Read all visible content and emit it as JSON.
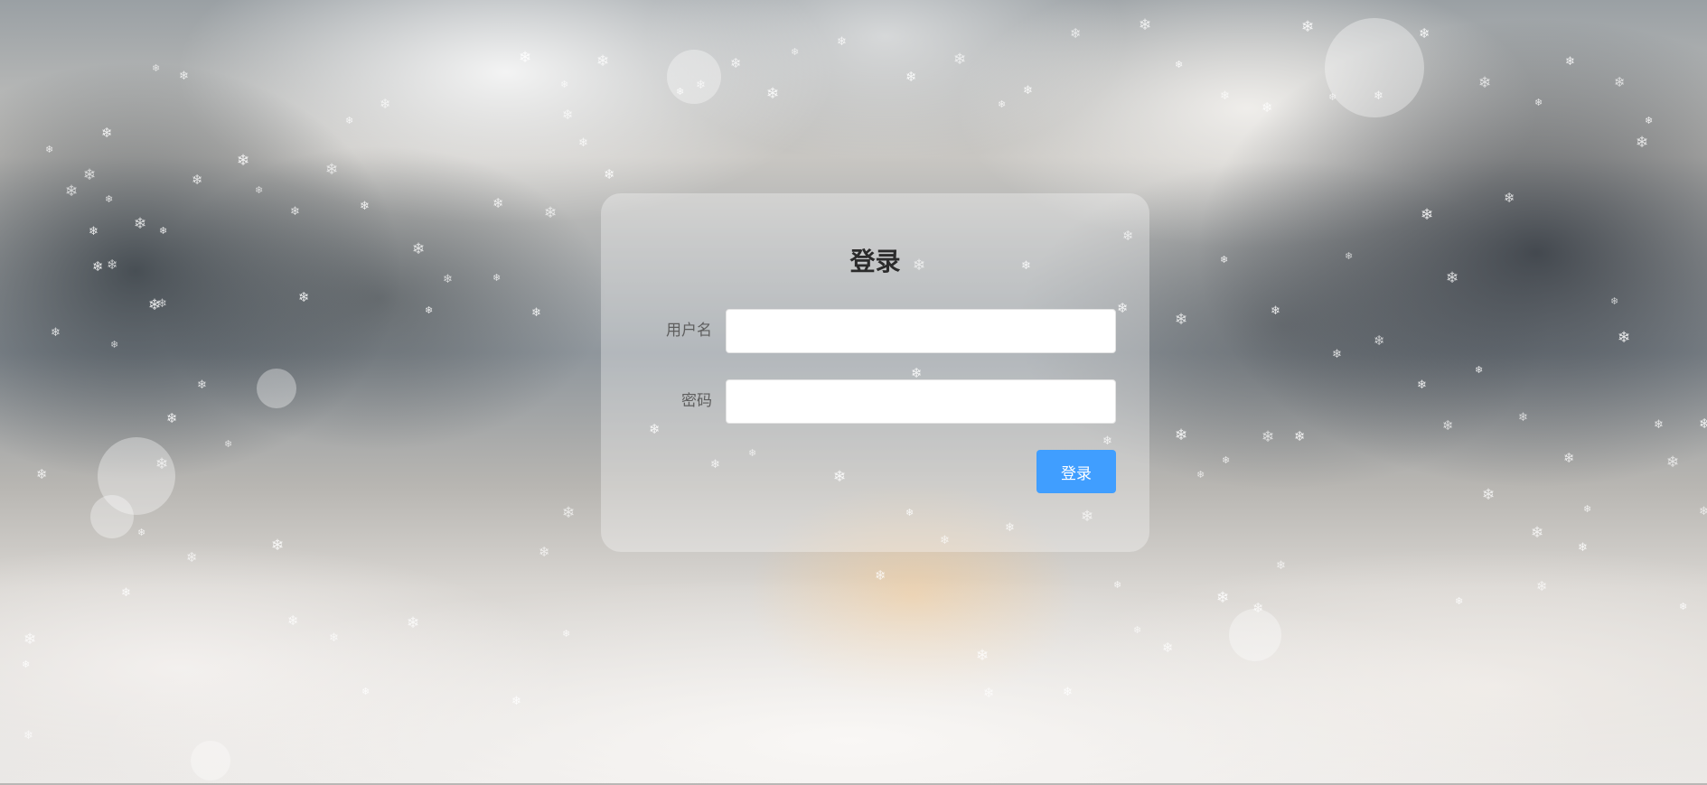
{
  "login": {
    "title": "登录",
    "username_label": "用户名",
    "username_value": "",
    "password_label": "密码",
    "password_value": "",
    "submit_label": "登录"
  },
  "colors": {
    "primary_button": "#409eff",
    "card_background": "rgba(255,255,255,0.32)",
    "title_text": "#2b2b2b",
    "label_text": "#5e5e5e"
  },
  "background": {
    "snowflake_glyph": "❄"
  }
}
